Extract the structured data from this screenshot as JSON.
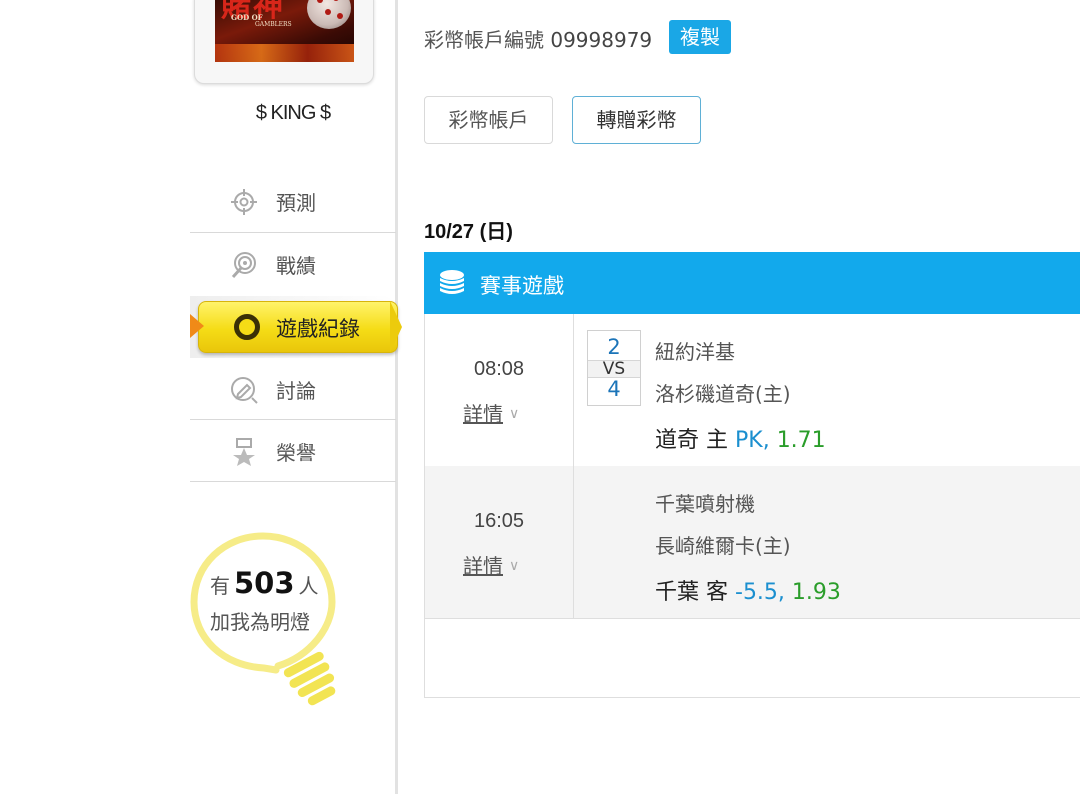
{
  "user": {
    "avatar_title_cjk": "賭神",
    "avatar_title_en1": "GOD OF",
    "avatar_title_en2": "GAMBLERS",
    "name": "$ KING $"
  },
  "nav": {
    "items": [
      {
        "label": "預測",
        "icon": "target-icon"
      },
      {
        "label": "戰績",
        "icon": "record-icon"
      },
      {
        "label": "遊戲紀錄",
        "icon": "ring-icon",
        "active": true
      },
      {
        "label": "討論",
        "icon": "discussion-icon"
      },
      {
        "label": "榮譽",
        "icon": "medal-icon"
      }
    ]
  },
  "fans": {
    "prefix": "有",
    "count": "503",
    "suffix": "人",
    "line2": "加我為明燈"
  },
  "account": {
    "label": "彩幣帳戶編號",
    "number": "09998979",
    "copy_label": "複製"
  },
  "tabs": {
    "wallet": "彩幣帳戶",
    "transfer": "轉贈彩幣"
  },
  "schedule": {
    "date": "10/27 (日)",
    "section_title": "賽事遊戲",
    "detail_label": "詳情",
    "games": [
      {
        "time": "08:08",
        "score_away": "2",
        "vs": "VS",
        "score_home": "4",
        "team_away": "紐約洋基",
        "team_home": "洛杉磯道奇(主)",
        "pick_team": "道奇 主",
        "pick_type": "PK,",
        "pick_odds": "1.71"
      },
      {
        "time": "16:05",
        "team_away": "千葉噴射機",
        "team_home": "長崎維爾卡(主)",
        "pick_team": "千葉 客",
        "pick_type": "-5.5,",
        "pick_odds": "1.93"
      }
    ]
  },
  "colors": {
    "accent_blue": "#12a9ec",
    "active_yellow": "#f5dc16",
    "odds_green": "#2a9d2a",
    "odds_blue": "#1b8fcf"
  }
}
